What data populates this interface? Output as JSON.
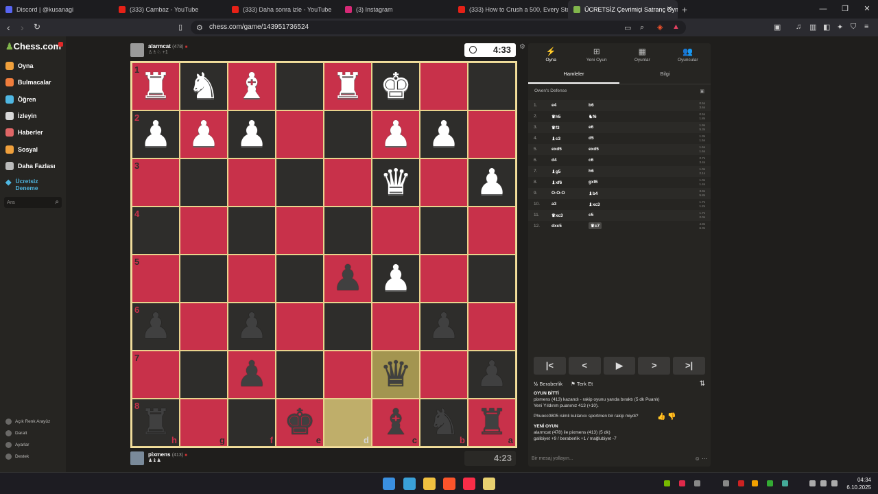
{
  "browser": {
    "tabs": [
      {
        "title": "Discord | @kusanagi",
        "color": "#5865f2",
        "active": false
      },
      {
        "title": "(333) Cambaz - YouTube",
        "color": "#e62117",
        "active": false
      },
      {
        "title": "(333) Daha sonra izle - YouTube",
        "color": "#e62117",
        "active": false
      },
      {
        "title": "(3) Instagram",
        "color": "#d62976",
        "active": false
      },
      {
        "title": "(333) How to Crush a 500, Every Step",
        "color": "#e62117",
        "active": false
      },
      {
        "title": "ÜCRETSİZ Çevrimiçi Satranç Oyn",
        "color": "#81b64c",
        "active": true
      }
    ],
    "url": "chess.com/game/143951736524"
  },
  "sidebar": {
    "logo": "Chess.com",
    "items": [
      {
        "label": "Oyna",
        "color": "#f0a03c"
      },
      {
        "label": "Bulmacalar",
        "color": "#f07d3c"
      },
      {
        "label": "Öğren",
        "color": "#4fb7e2"
      },
      {
        "label": "İzleyin",
        "color": "#d8d8d8"
      },
      {
        "label": "Haberler",
        "color": "#e06666"
      },
      {
        "label": "Sosyal",
        "color": "#f0a03c"
      },
      {
        "label": "Daha Fazlası",
        "color": "#bbbbbb"
      }
    ],
    "premium": "Ücretsiz Deneme",
    "search_placeholder": "Ara",
    "footer": [
      "Açık Renk Arayüz",
      "Daralt",
      "Ayarlar",
      "Destek"
    ]
  },
  "top_player": {
    "name": "alarmcat",
    "rating": "(478)",
    "captured": "+1",
    "clock": "4:33"
  },
  "bottom_player": {
    "name": "pixmens",
    "rating": "(413)",
    "clock": "4:23"
  },
  "board": {
    "rows": [
      [
        "wR",
        "wN",
        "wB",
        "",
        "wR",
        "wK",
        "",
        ""
      ],
      [
        "wP",
        "wP",
        "wP",
        "",
        "",
        "wP",
        "wP",
        ""
      ],
      [
        "",
        "",
        "",
        "",
        "",
        "wQ",
        "",
        "wP"
      ],
      [
        "",
        "",
        "",
        "",
        "",
        "",
        "",
        ""
      ],
      [
        "",
        "",
        "",
        "",
        "bP",
        "wP",
        "",
        ""
      ],
      [
        "bP",
        "",
        "bP",
        "",
        "",
        "",
        "bP",
        ""
      ],
      [
        "",
        "",
        "bP",
        "",
        "",
        "bQ",
        "",
        "bP"
      ],
      [
        "bR",
        "",
        "",
        "bK",
        "",
        "bB",
        "bN",
        "bR"
      ]
    ],
    "rank_labels": [
      "1",
      "2",
      "3",
      "4",
      "5",
      "6",
      "7",
      "8"
    ],
    "file_labels": [
      "h",
      "g",
      "f",
      "e",
      "d",
      "c",
      "b",
      "a"
    ],
    "highlight": [
      [
        6,
        5
      ],
      [
        7,
        4
      ]
    ]
  },
  "panel": {
    "tabs": [
      "Oyna",
      "Yeni Oyun",
      "Oyunlar",
      "Oyuncular"
    ],
    "subtabs": [
      "Hamleler",
      "Bilgi"
    ],
    "opening": "Owen's Defense",
    "moves": [
      {
        "n": "1.",
        "w": "e4",
        "b": "b6",
        "t1": "0.5s",
        "t2": "3.6s"
      },
      {
        "n": "2.",
        "w": "♛h5",
        "b": "♞f6",
        "t1": "0.5s",
        "t2": "1.8s"
      },
      {
        "n": "3.",
        "w": "♛f3",
        "b": "e6",
        "t1": "1.9s",
        "t2": "5.3s"
      },
      {
        "n": "4.",
        "w": "♝c3",
        "b": "d5",
        "t1": "1.3s",
        "t2": "1.5s"
      },
      {
        "n": "5.",
        "w": "exd5",
        "b": "exd5",
        "t1": "1.6s",
        "t2": "1.6s"
      },
      {
        "n": "6.",
        "w": "d4",
        "b": "c6",
        "t1": "2.7s",
        "t2": "3.4s"
      },
      {
        "n": "7.",
        "w": "♝g5",
        "b": "h6",
        "t1": "1.0s",
        "t2": "2.1s"
      },
      {
        "n": "8.",
        "w": "♝xf6",
        "b": "gxf6",
        "t1": "1.0s",
        "t2": "1.4s"
      },
      {
        "n": "9.",
        "w": "O-O-O",
        "b": "♝b4",
        "t1": "3.9s",
        "t2": "5.8s"
      },
      {
        "n": "10.",
        "w": "a3",
        "b": "♝xc3",
        "t1": "1.7s",
        "t2": "1.2s"
      },
      {
        "n": "11.",
        "w": "♛xc3",
        "b": "c5",
        "t1": "1.7s",
        "t2": "2.0s"
      },
      {
        "n": "12.",
        "w": "dxc5",
        "b": "♛c7",
        "t1": "4.8s",
        "t2": "6.3s"
      }
    ],
    "controls": [
      "|<",
      "<",
      "▶",
      ">",
      ">|"
    ],
    "draw": "Beraberlik",
    "resign": "Terk Et",
    "chat": [
      {
        "text": "OYUN BİTTİ",
        "h": true
      },
      {
        "text": "pixmens (413) kazandı - rakip oyunu yarıda bıraktı (5 dk Puanlı)",
        "h": false
      },
      {
        "text": "Yeni Yıldırım puanınız 413 (+10).",
        "h": false
      },
      {
        "text": "",
        "h": false
      },
      {
        "text": "Phuocc0805 isimli kullanıcı sportmen bir rakip miydi?",
        "h": false
      },
      {
        "text": "",
        "h": false
      },
      {
        "text": "YENİ OYUN",
        "h": true
      },
      {
        "text": "alarmcat (478) ile pixmens (413) (5 dk)",
        "h": false
      },
      {
        "text": "galibiyet +9 / beraberlik +1 / mağlubiyet -7",
        "h": false
      }
    ],
    "chat_placeholder": "Bir mesaj yollayın..."
  },
  "taskbar": {
    "time": "04:34",
    "date": "6.10.2025"
  }
}
